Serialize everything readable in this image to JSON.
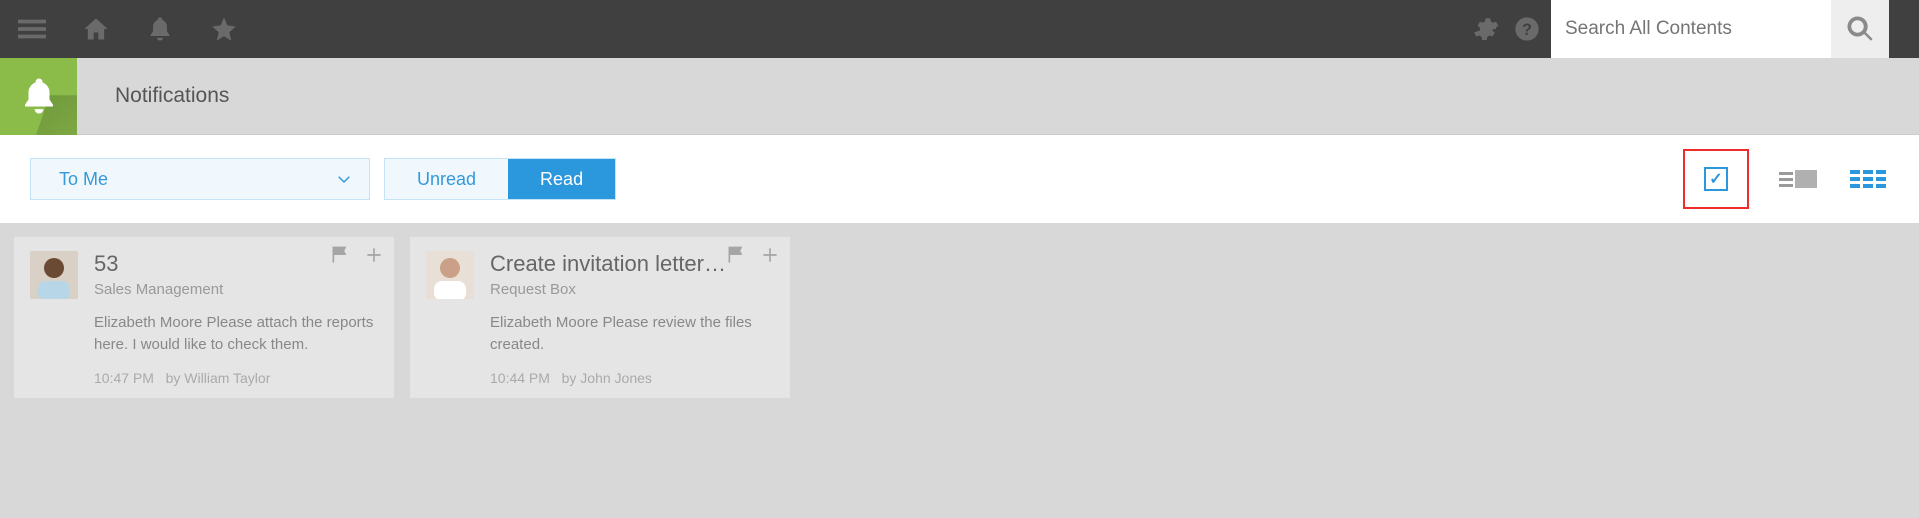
{
  "topbar": {
    "search_placeholder": "Search All Contents"
  },
  "page": {
    "title": "Notifications"
  },
  "toolbar": {
    "filter_label": "To Me",
    "unread_label": "Unread",
    "read_label": "Read"
  },
  "cards": [
    {
      "title": "53",
      "subtitle": "Sales Management",
      "text": "Elizabeth Moore Please attach the reports here. I would like to check them.",
      "time": "10:47 PM",
      "by": "by William Taylor"
    },
    {
      "title": "Create invitation letter…",
      "subtitle": "Request Box",
      "text": "Elizabeth Moore Please review the files created.",
      "time": "10:44 PM",
      "by": "by John Jones"
    }
  ]
}
